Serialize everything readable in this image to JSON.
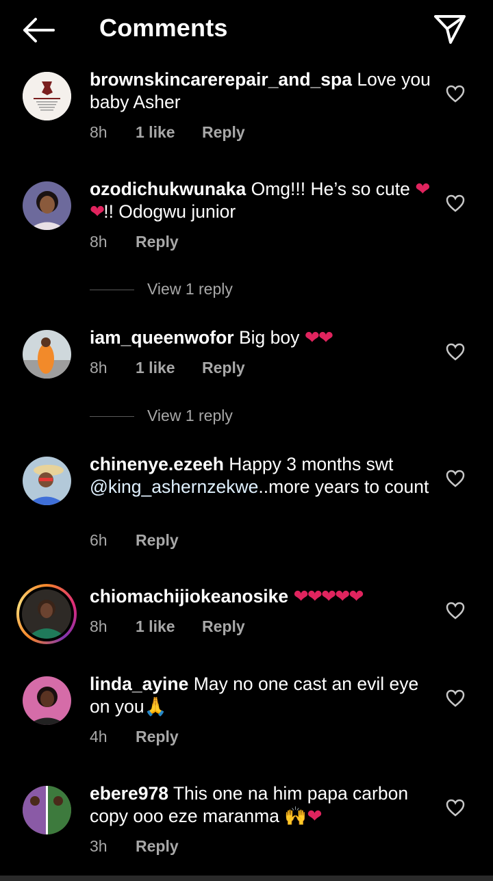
{
  "header": {
    "title": "Comments"
  },
  "comments": [
    {
      "username": "brownskincarerepair_and_spa",
      "text": "Love you baby Asher",
      "time": "8h",
      "likes": "1 like",
      "reply": "Reply"
    },
    {
      "username": "ozodichukwunaka",
      "text": "Omg!!! He’s so cute",
      "hearts": "❤❤",
      "text2": "!! Odogwu junior",
      "time": "8h",
      "reply": "Reply",
      "view_replies": "View 1 reply"
    },
    {
      "username": "iam_queenwofor",
      "text": "Big boy",
      "hearts": "❤❤",
      "time": "8h",
      "likes": "1 like",
      "reply": "Reply",
      "view_replies": "View 1 reply"
    },
    {
      "username": "chinenye.ezeeh",
      "text": "Happy 3 months swt",
      "mention": "@king_ashernzekwe",
      "text2": "..more years to count",
      "time": "6h",
      "reply": "Reply"
    },
    {
      "username": "chiomachijiokeanosike",
      "hearts": "❤❤❤❤❤",
      "time": "8h",
      "likes": "1 like",
      "reply": "Reply"
    },
    {
      "username": "linda_ayine",
      "text": "May no one cast an evil eye on you",
      "emoji": "🙏",
      "time": "4h",
      "reply": "Reply"
    },
    {
      "username": "ebere978",
      "text": "This one na him papa carbon copy ooo eze maranma",
      "emoji": "🙌",
      "hearts": "❤",
      "time": "3h",
      "reply": "Reply"
    }
  ]
}
